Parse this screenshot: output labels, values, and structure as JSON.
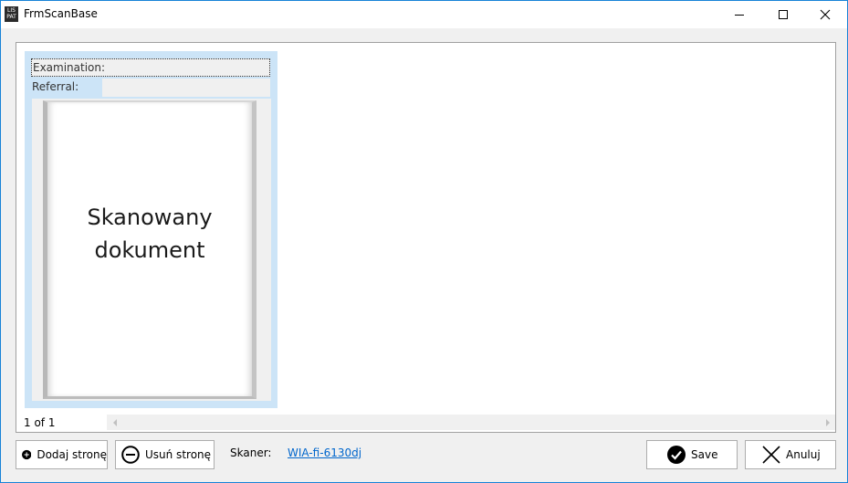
{
  "window": {
    "title": "FrmScanBase",
    "icon_text_top": "LIS",
    "icon_text_bottom": "PAT"
  },
  "scan_card": {
    "examination_label": "Examination:",
    "referral_label": "Referral:",
    "page_text_line1": "Skanowany",
    "page_text_line2": "dokument"
  },
  "status": {
    "page_count": "1 of 1"
  },
  "toolbar": {
    "add_page_label": "Dodaj stronę",
    "remove_page_label": "Usuń stronę",
    "scanner_label": "Skaner:",
    "scanner_value": "WIA-fi-6130dj",
    "save_label": "Save",
    "cancel_label": "Anuluj"
  },
  "colors": {
    "accent": "#1883d7",
    "card_bg": "#cce4f7",
    "link": "#0066cc"
  }
}
